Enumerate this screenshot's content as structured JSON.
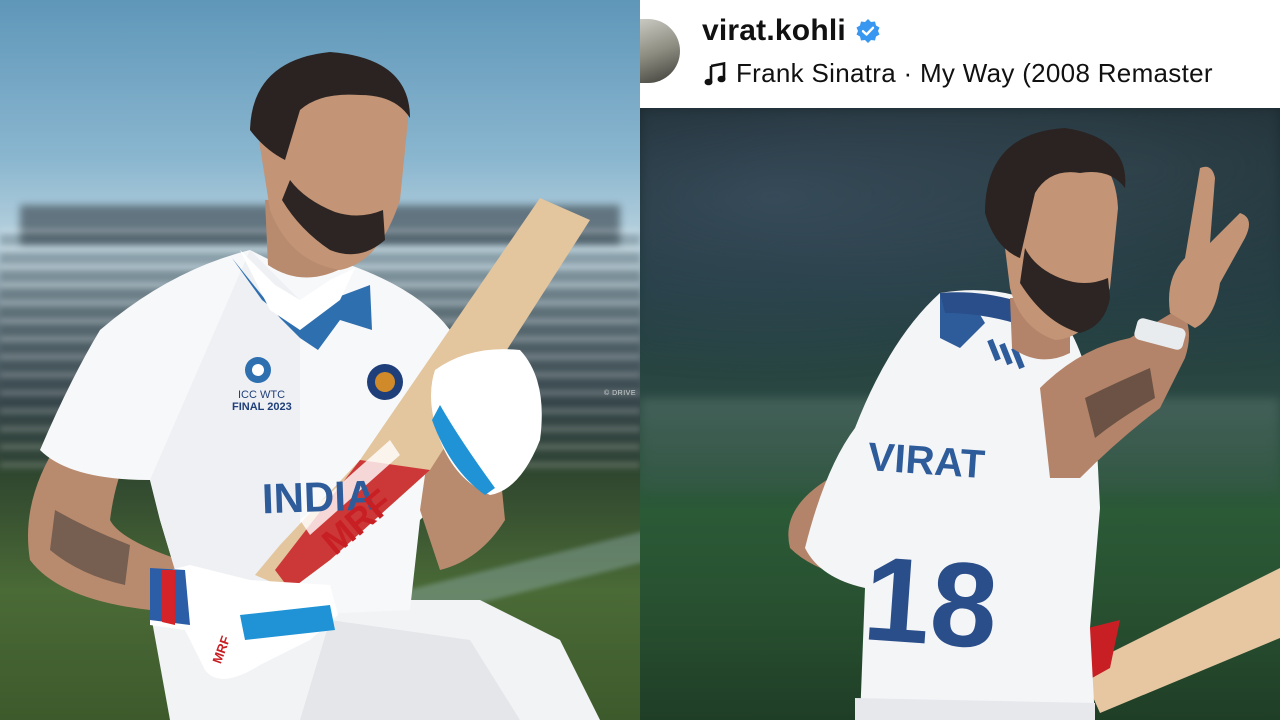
{
  "left_photo": {
    "chest_logo_text_line1": "ICC WTC",
    "chest_logo_text_line2": "FINAL 2023",
    "jersey_text": "INDIA",
    "bat_brand": "MRF",
    "glove_brand": "MRF",
    "watermark": "© DRIVE"
  },
  "post": {
    "username": "virat.kohli",
    "verified_badge": "verified-icon",
    "song": "Frank Sinatra · My Way (2008 Remaster",
    "accent_color": "#3897f0"
  },
  "right_photo": {
    "jersey_name": "VIRAT",
    "jersey_number": "18"
  }
}
